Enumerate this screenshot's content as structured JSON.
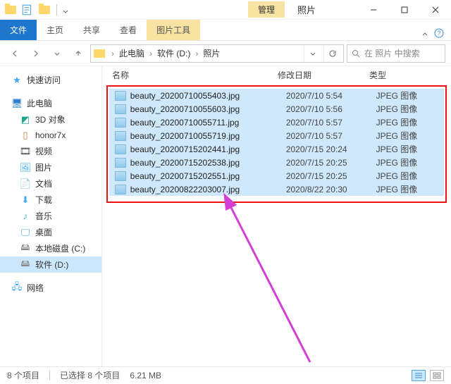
{
  "titlebar": {
    "context_tab": "管理",
    "window_title": "照片"
  },
  "ribbon": {
    "file": "文件",
    "home": "主页",
    "share": "共享",
    "view": "查看",
    "picture_tools": "图片工具"
  },
  "breadcrumbs": [
    "此电脑",
    "软件 (D:)",
    "照片"
  ],
  "search": {
    "placeholder": "在 照片 中搜索"
  },
  "sidebar": {
    "quick": "快速访问",
    "thispc": "此电脑",
    "items": [
      {
        "label": "3D 对象"
      },
      {
        "label": "honor7x"
      },
      {
        "label": "视频"
      },
      {
        "label": "图片"
      },
      {
        "label": "文档"
      },
      {
        "label": "下载"
      },
      {
        "label": "音乐"
      },
      {
        "label": "桌面"
      },
      {
        "label": "本地磁盘 (C:)"
      },
      {
        "label": "软件 (D:)"
      }
    ],
    "network": "网络"
  },
  "columns": {
    "name": "名称",
    "date": "修改日期",
    "type": "类型"
  },
  "files": [
    {
      "name": "beauty_20200710055403.jpg",
      "date": "2020/7/10 5:54",
      "type": "JPEG 图像"
    },
    {
      "name": "beauty_20200710055603.jpg",
      "date": "2020/7/10 5:56",
      "type": "JPEG 图像"
    },
    {
      "name": "beauty_20200710055711.jpg",
      "date": "2020/7/10 5:57",
      "type": "JPEG 图像"
    },
    {
      "name": "beauty_20200710055719.jpg",
      "date": "2020/7/10 5:57",
      "type": "JPEG 图像"
    },
    {
      "name": "beauty_20200715202441.jpg",
      "date": "2020/7/15 20:24",
      "type": "JPEG 图像"
    },
    {
      "name": "beauty_20200715202538.jpg",
      "date": "2020/7/15 20:25",
      "type": "JPEG 图像"
    },
    {
      "name": "beauty_20200715202551.jpg",
      "date": "2020/7/15 20:25",
      "type": "JPEG 图像"
    },
    {
      "name": "beauty_20200822203007.jpg",
      "date": "2020/8/22 20:30",
      "type": "JPEG 图像"
    }
  ],
  "status": {
    "count": "8 个项目",
    "selection": "已选择 8 个项目",
    "size": "6.21 MB"
  }
}
